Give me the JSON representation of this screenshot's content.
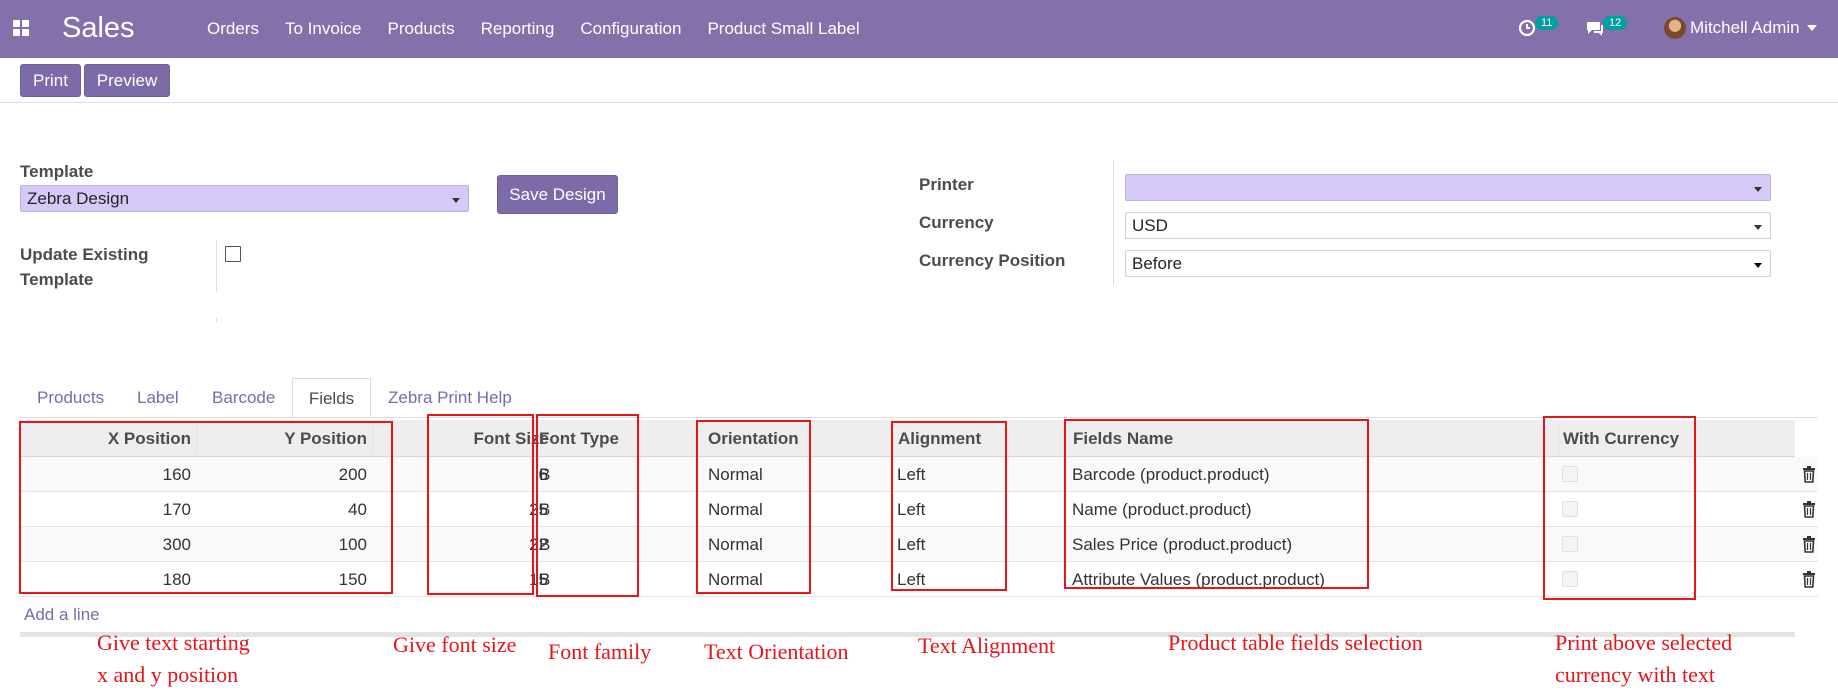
{
  "navbar": {
    "app_name": "Sales",
    "menu": [
      "Orders",
      "To Invoice",
      "Products",
      "Reporting",
      "Configuration",
      "Product Small Label"
    ],
    "activities_badge": "11",
    "messages_badge": "12",
    "user": "Mitchell Admin",
    "color": "#8470ab"
  },
  "control_panel": {
    "print": "Print",
    "preview": "Preview"
  },
  "form": {
    "template_label": "Template",
    "template_value": "Zebra Design",
    "save_design": "Save Design",
    "update_label": "Update Existing\nTemplate",
    "printer_label": "Printer",
    "printer_value": "",
    "currency_label": "Currency",
    "currency_value": "USD",
    "currency_position_label": "Currency Position",
    "currency_position_value": "Before"
  },
  "tabs": [
    "Products",
    "Label",
    "Barcode",
    "Fields",
    "Zebra Print Help"
  ],
  "active_tab": "Fields",
  "table": {
    "headers": {
      "x": "X Position",
      "y": "Y Position",
      "font_size": "Font Size",
      "font_type": "Font Type",
      "orientation": "Orientation",
      "alignment": "Alignment",
      "fields_name": "Fields Name",
      "with_currency": "With Currency"
    },
    "rows": [
      {
        "x": "160",
        "y": "200",
        "font_size": "6",
        "font_type": "B",
        "orientation": "Normal",
        "alignment": "Left",
        "field": "Barcode (product.product)"
      },
      {
        "x": "170",
        "y": "40",
        "font_size": "25",
        "font_type": "B",
        "orientation": "Normal",
        "alignment": "Left",
        "field": "Name (product.product)"
      },
      {
        "x": "300",
        "y": "100",
        "font_size": "22",
        "font_type": "B",
        "orientation": "Normal",
        "alignment": "Left",
        "field": "Sales Price (product.product)"
      },
      {
        "x": "180",
        "y": "150",
        "font_size": "15",
        "font_type": "B",
        "orientation": "Normal",
        "alignment": "Left",
        "field": "Attribute Values (product.product)"
      }
    ],
    "add_line": "Add a line"
  },
  "annotations": {
    "xy": "Give text starting\nx and y position",
    "font_size": "Give font size",
    "font_family": "Font family",
    "orientation": "Text Orientation",
    "alignment": "Text Alignment",
    "fields": "Product table fields selection",
    "currency": "Print above selected\ncurrency with text",
    "color": "#e8141a"
  }
}
